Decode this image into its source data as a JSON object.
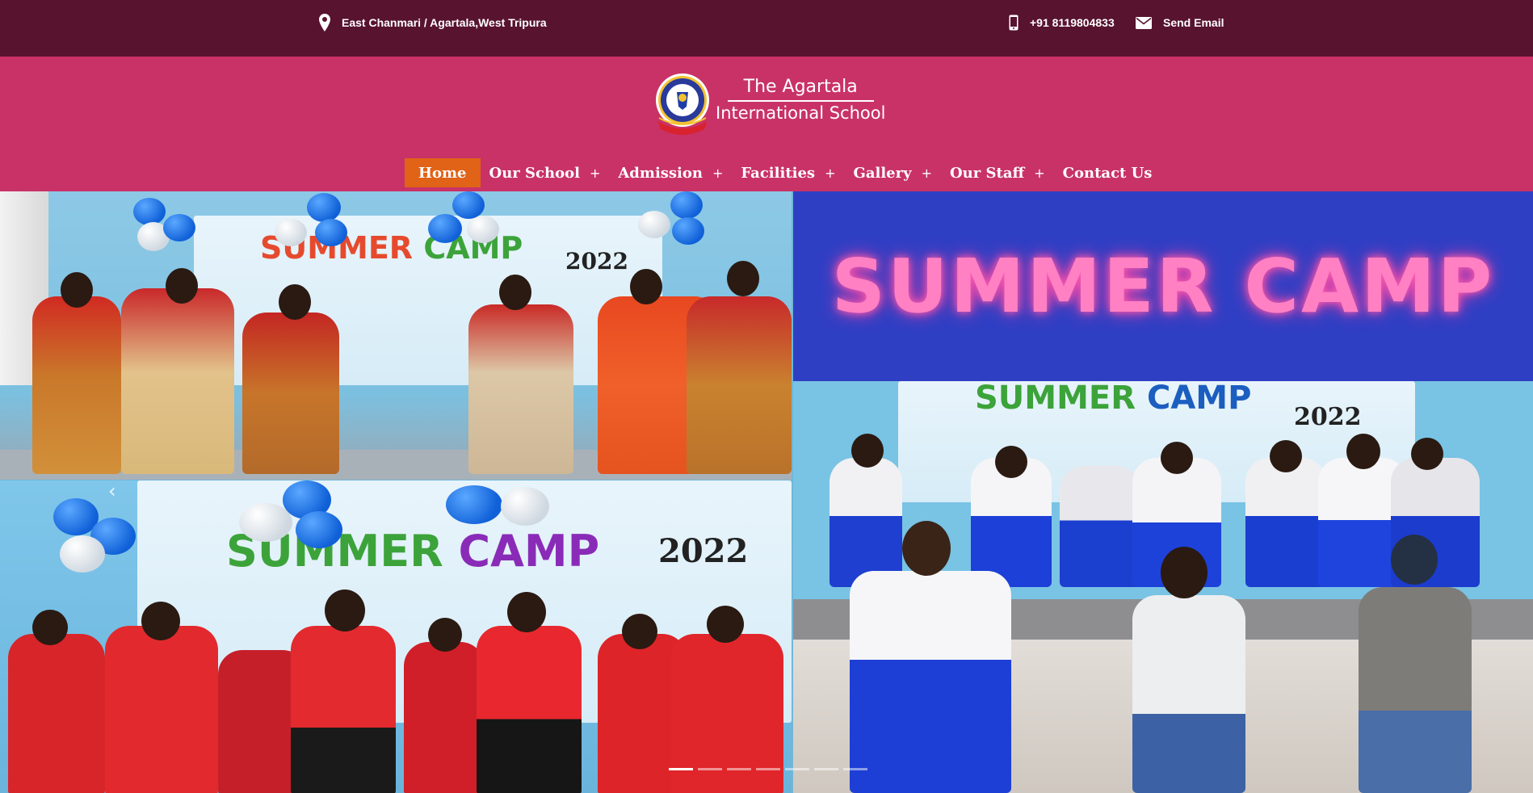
{
  "topbar": {
    "address": "East Chanmari / Agartala,West Tripura",
    "phone": "+91 8119804833",
    "email_label": "Send Email"
  },
  "brand": {
    "line1": "The Agartala",
    "line2": "International School"
  },
  "nav": {
    "items": [
      {
        "label": "Home",
        "active": true,
        "has_submenu": false
      },
      {
        "label": "Our School",
        "has_submenu": true
      },
      {
        "label": "Admission",
        "has_submenu": true
      },
      {
        "label": "Facilities",
        "has_submenu": true
      },
      {
        "label": "Gallery",
        "has_submenu": true
      },
      {
        "label": "Our Staff",
        "has_submenu": true
      },
      {
        "label": "Contact Us",
        "has_submenu": false
      }
    ],
    "submenu_symbol": "+"
  },
  "slider": {
    "headline": "SUMMER CAMP",
    "banner_word_1": "SUMMER",
    "banner_word_2": "CAMP",
    "banner_year": "2022",
    "prev_arrow": "‹",
    "slide_count": 7,
    "active_slide": 1
  },
  "colors": {
    "topbar_bg": "#58132f",
    "header_bg": "#c93267",
    "nav_active_bg": "#e06317",
    "headline_band": "#2f3fc4",
    "headline_text": "#ff80c3"
  },
  "icons": [
    "location-pin-icon",
    "phone-icon",
    "envelope-icon",
    "school-seal-logo",
    "chevron-left-icon"
  ]
}
